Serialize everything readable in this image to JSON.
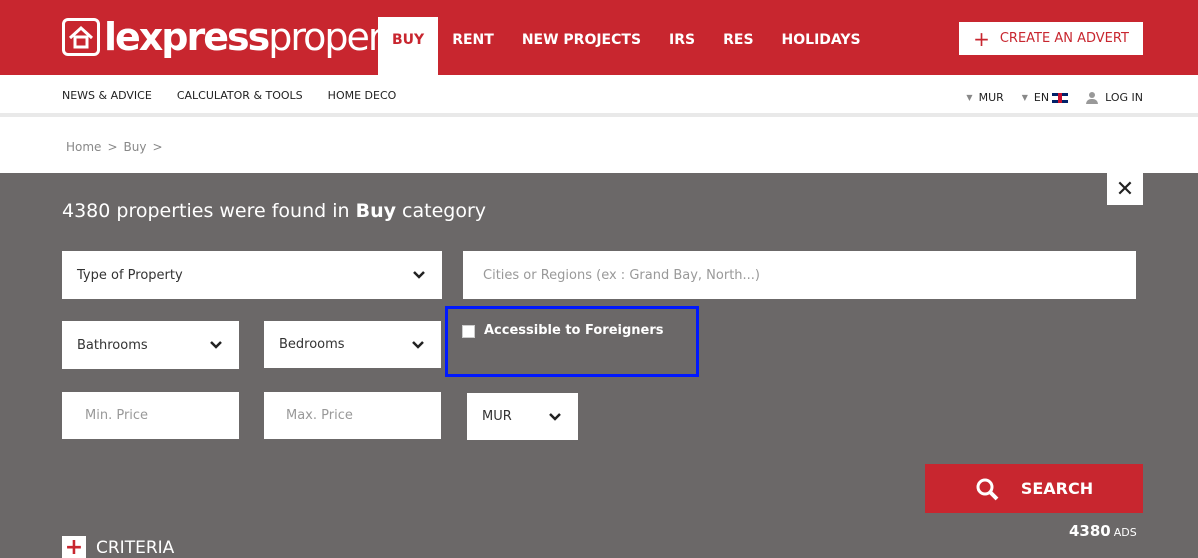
{
  "header": {
    "logo_bold": "lexpress",
    "logo_light": "property",
    "nav": [
      {
        "label": "BUY",
        "active": true
      },
      {
        "label": "RENT"
      },
      {
        "label": "NEW PROJECTS"
      },
      {
        "label": "IRS"
      },
      {
        "label": "RES"
      },
      {
        "label": "HOLIDAYS"
      }
    ],
    "create_advert_label": "CREATE AN ADVERT",
    "colors": {
      "brand": "#c8262f",
      "panel": "#6b6868",
      "highlight": "#0019ff"
    }
  },
  "subnav": {
    "items": [
      "NEWS & ADVICE",
      "CALCULATOR & TOOLS",
      "HOME DECO"
    ],
    "currency": "MUR",
    "language": "EN",
    "login": "LOG IN"
  },
  "breadcrumb": [
    "Home",
    ">",
    "Buy",
    ">"
  ],
  "results": {
    "count": "4380",
    "text_mid": " properties were found in ",
    "category": "Buy",
    "text_end": " category"
  },
  "filters": {
    "type_of_property": "Type of Property",
    "location_placeholder": "Cities or Regions (ex : Grand Bay, North...)",
    "bathrooms": "Bathrooms",
    "bedrooms": "Bedrooms",
    "accessible_foreigners": "Accessible to Foreigners",
    "accessible_checked": false,
    "min_price_placeholder": "Min. Price",
    "max_price_placeholder": "Max. Price",
    "currency": "MUR"
  },
  "search_label": "SEARCH",
  "ads_count": "4380",
  "ads_label": "ADS",
  "criteria_label": "CRITERIA",
  "icons": {
    "close": "close-icon",
    "search": "search-icon",
    "chevron": "chevron-down-icon",
    "user": "user-icon",
    "flag": "uk-flag-icon",
    "plus": "plus-icon"
  }
}
